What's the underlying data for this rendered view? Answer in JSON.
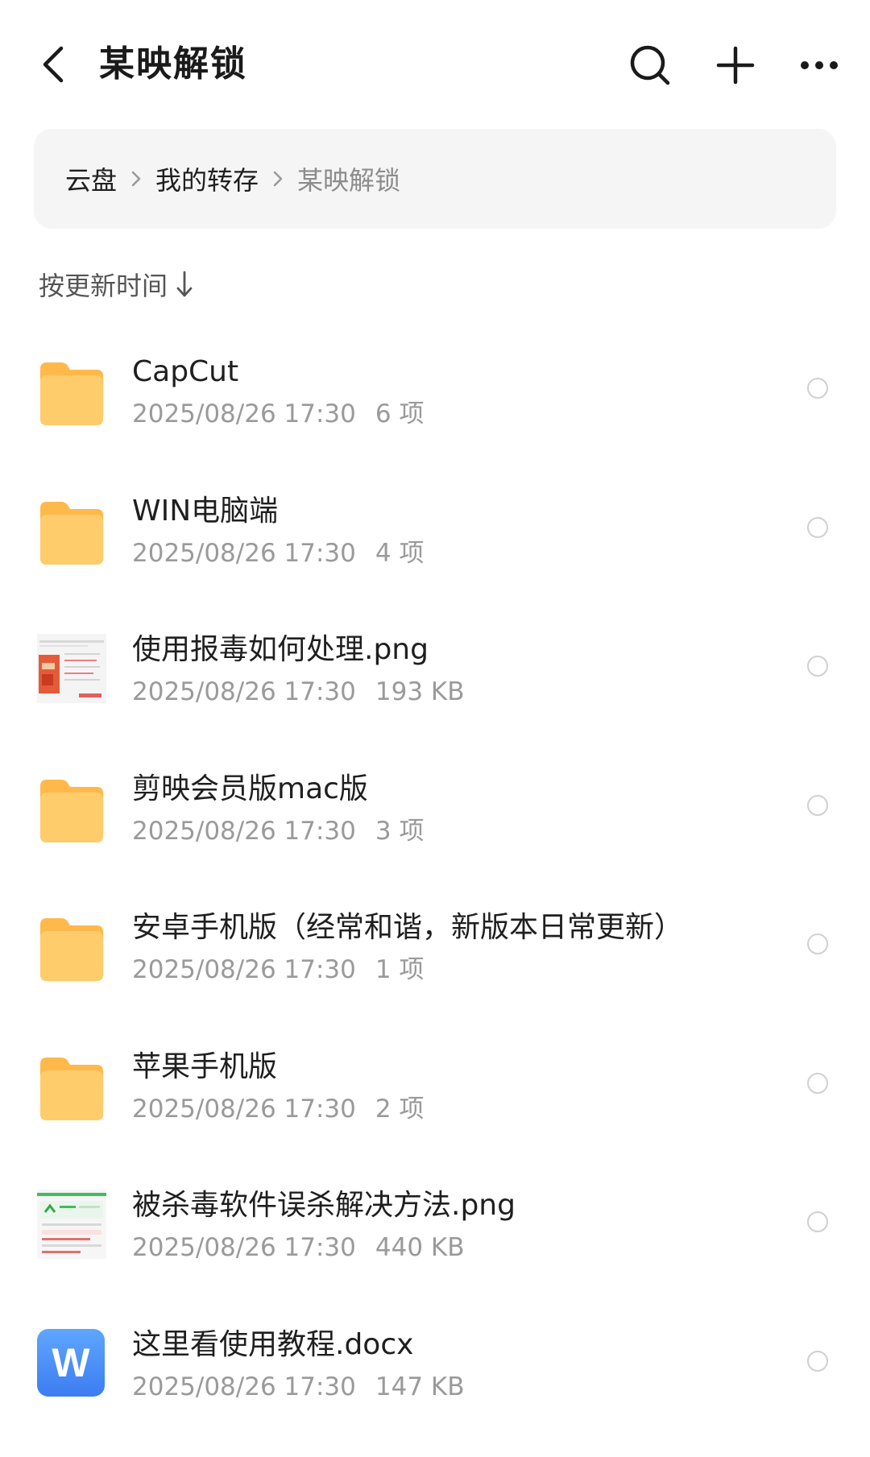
{
  "header": {
    "title": "某映解锁",
    "back_icon": "back-arrow-icon",
    "search_icon": "search-icon",
    "add_icon": "plus-icon",
    "more_icon": "more-icon"
  },
  "breadcrumb": {
    "items": [
      "云盘",
      "我的转存",
      "某映解锁"
    ]
  },
  "sort": {
    "label": "按更新时间"
  },
  "files": [
    {
      "name": "CapCut",
      "date": "2025/08/26 17:30",
      "size": "6 项",
      "kind": "folder"
    },
    {
      "name": "WIN电脑端",
      "date": "2025/08/26 17:30",
      "size": "4 项",
      "kind": "folder"
    },
    {
      "name": "使用报毒如何处理.png",
      "date": "2025/08/26 17:30",
      "size": "193 KB",
      "kind": "image"
    },
    {
      "name": "剪映会员版mac版",
      "date": "2025/08/26 17:30",
      "size": "3 项",
      "kind": "folder"
    },
    {
      "name": "安卓手机版（经常和谐，新版本日常更新）",
      "date": "2025/08/26 17:30",
      "size": "1 项",
      "kind": "folder"
    },
    {
      "name": "苹果手机版",
      "date": "2025/08/26 17:30",
      "size": "2 项",
      "kind": "folder"
    },
    {
      "name": "被杀毒软件误杀解决方法.png",
      "date": "2025/08/26 17:30",
      "size": "440 KB",
      "kind": "image"
    },
    {
      "name": "这里看使用教程.docx",
      "date": "2025/08/26 17:30",
      "size": "147 KB",
      "kind": "word",
      "icon_letter": "W"
    }
  ],
  "colors": {
    "folder": "#FFC15A",
    "word": "#4A8CF7",
    "breadcrumb_bg": "#F5F5F5"
  }
}
